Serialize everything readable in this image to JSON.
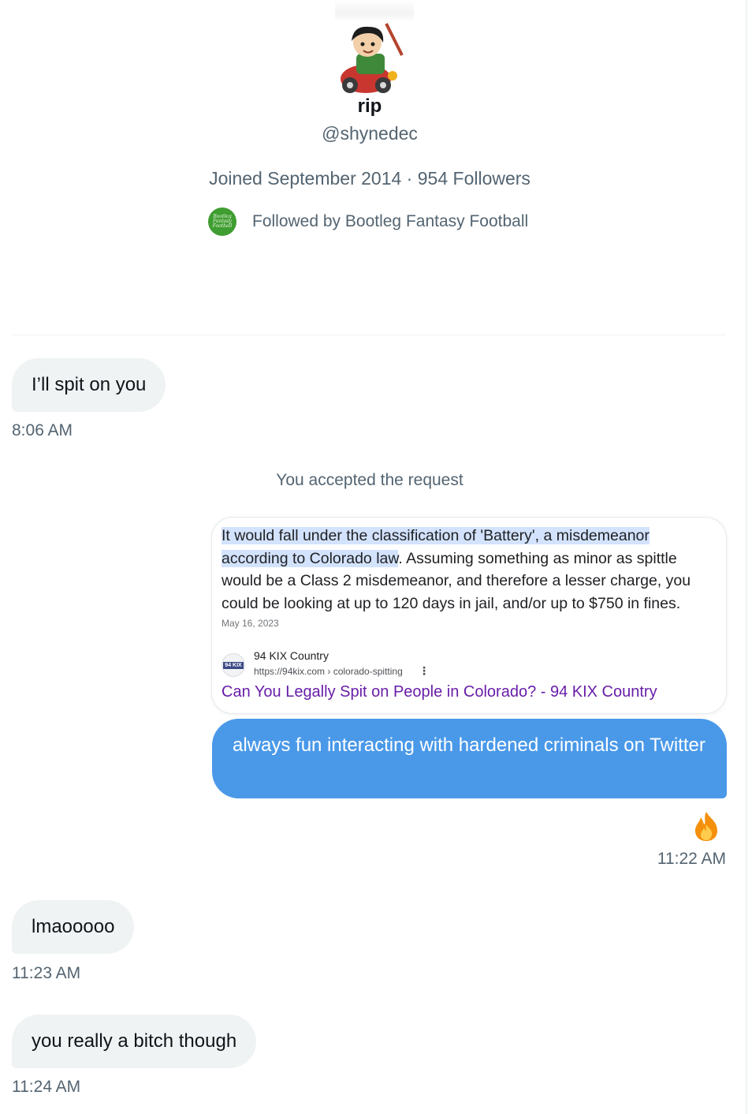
{
  "profile": {
    "name": "rip",
    "handle": "@shynedec",
    "joined": "Joined September 2014",
    "separator": " · ",
    "followers": "954 Followers",
    "followed_by": "Followed by Bootleg Fantasy Football",
    "followed_by_logo_text": "Bootleg Fantasy Football"
  },
  "messages": [
    {
      "direction": "incoming",
      "text": "I’ll spit on you",
      "time": "8:06 AM"
    },
    {
      "direction": "incoming",
      "text": "lmaooooo",
      "time": "11:23 AM"
    },
    {
      "direction": "incoming",
      "text": "you really a bitch though",
      "time": "11:24 AM"
    }
  ],
  "system_message": "You accepted the request",
  "outgoing": {
    "attachment": {
      "snippet_highlight": "It would fall under the classification of 'Battery', a misdemeanor according to Colorado law",
      "snippet_rest": ". Assuming something as minor as spittle would be a Class 2 misdemeanor, and therefore a lesser charge, you could be looking at up to 120 days in jail, and/or up to $750 in fines.",
      "date": "May 16, 2023",
      "source_icon": "94 KIX",
      "source_name": "94 KIX Country",
      "source_url": "https://94kix.com › colorado-spitting",
      "source_title": "Can You Legally Spit on People in Colorado? - 94 KIX Country"
    },
    "text": "always fun interacting with hardened criminals on Twitter",
    "reaction": "fire-emoji",
    "time": "11:22 AM"
  },
  "colors": {
    "outgoing_bubble": "#4a99e9",
    "incoming_bubble": "#eff3f4",
    "secondary_text": "#536471",
    "link_purple": "#681da8",
    "highlight": "#d3e3fd"
  }
}
